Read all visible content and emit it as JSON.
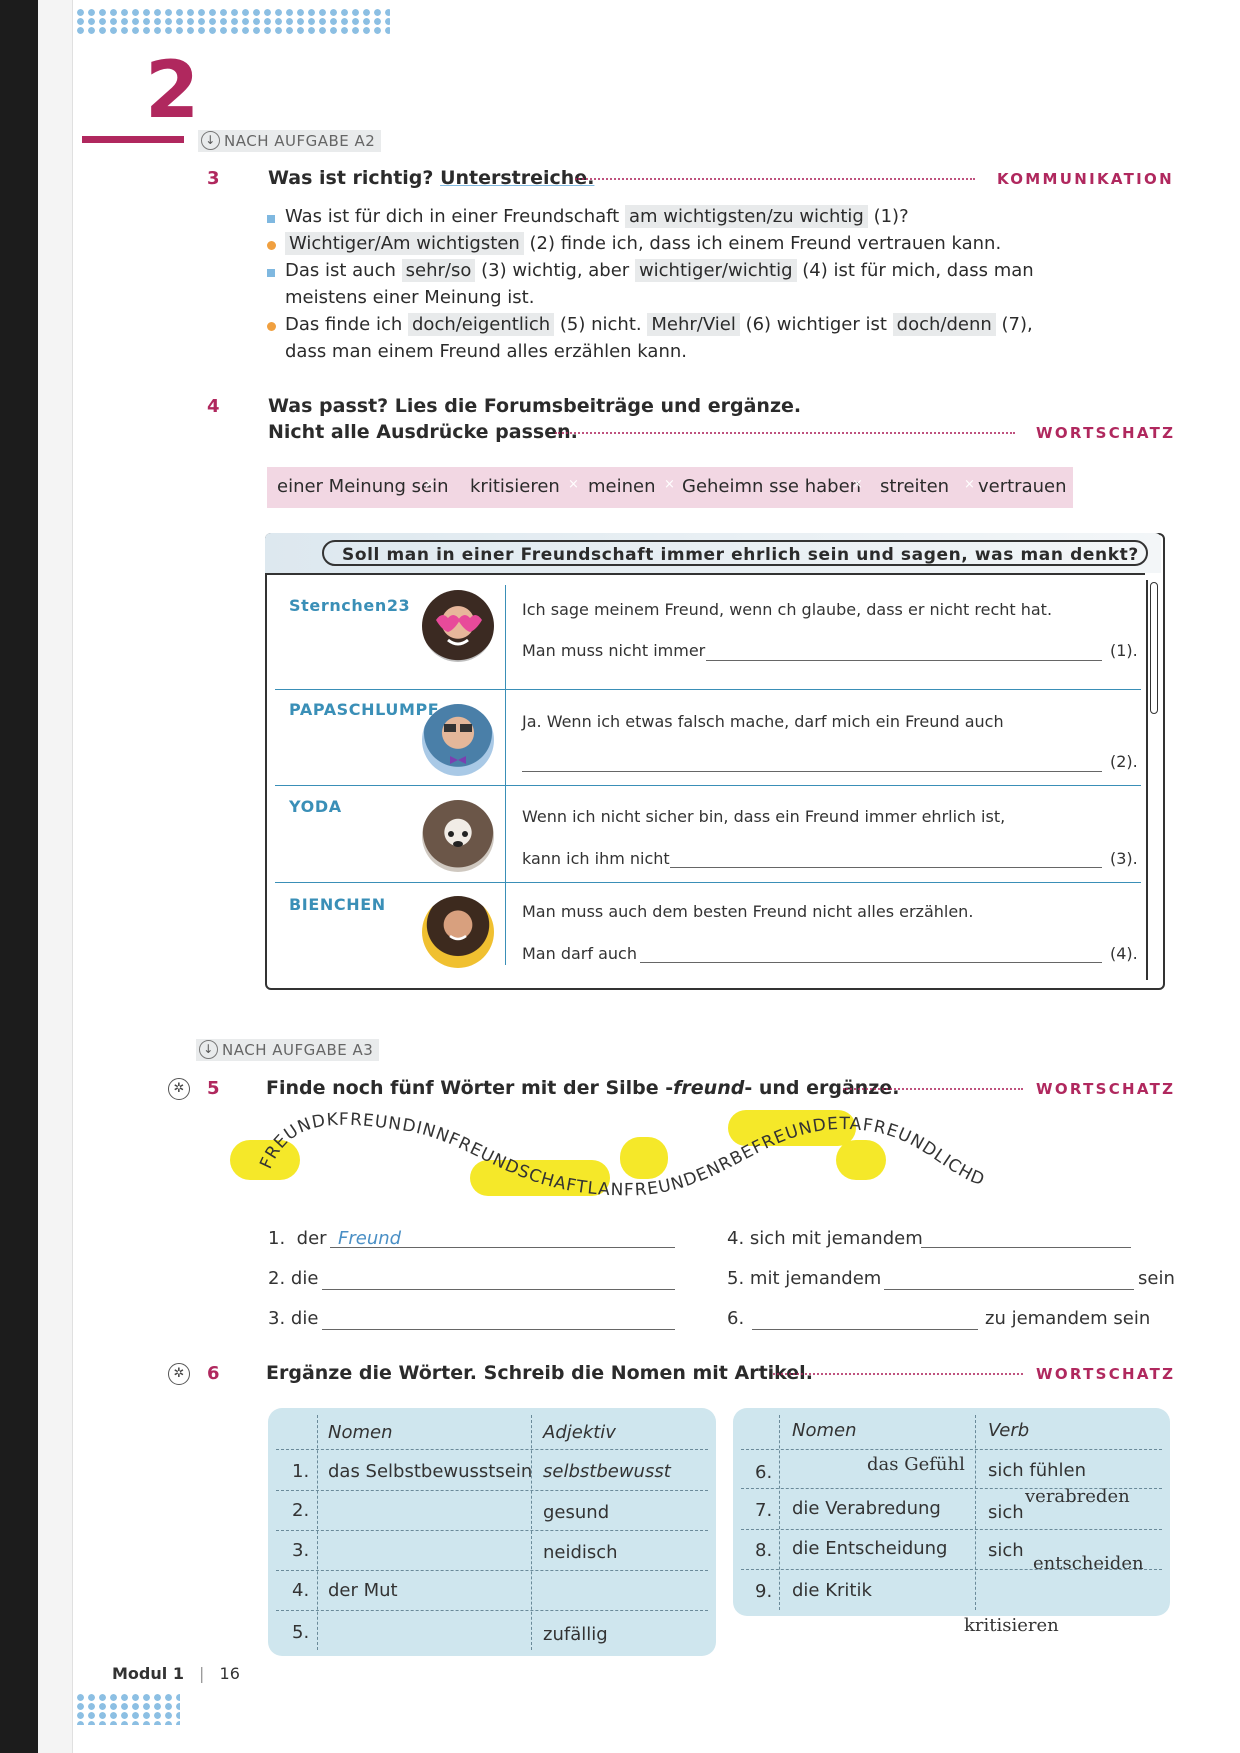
{
  "page": {
    "chapter_number": "2",
    "footer_module": "Modul 1",
    "footer_sep": "|",
    "footer_page": "16"
  },
  "section_a2": {
    "label": "NACH AUFGABE A2"
  },
  "ex3": {
    "number": "3",
    "title_a": "Was ist richtig?",
    "title_b": "Unterstreiche.",
    "tag": "KOMMUNIKATION",
    "lines": [
      {
        "pre": "Was ist für dich in einer Freundschaft",
        "opt": "am wichtigsten/zu wichtig",
        "post": "(1)?"
      },
      {
        "pre": "",
        "opt": "Wichtiger/Am wichtigsten",
        "post": "(2) finde ich, dass ich einem Freund vertrauen kann."
      },
      {
        "pre": "Das ist auch",
        "opt": "sehr/so",
        "mid": "(3) wichtig, aber",
        "opt2": "wichtiger/wichtig",
        "post": "(4) ist für mich, dass man"
      },
      {
        "pre": "meistens einer Meinung ist."
      },
      {
        "pre": "Das finde ich",
        "opt": "doch/eigentlich",
        "mid": "(5) nicht.",
        "opt2": "Mehr/Viel",
        "mid2": "(6) wichtiger ist",
        "opt3": "doch/denn",
        "post": "(7),"
      },
      {
        "pre": "dass man einem Freund alles erzählen kann."
      }
    ]
  },
  "ex4": {
    "number": "4",
    "title_l1": "Was passt? Lies die Forumsbeiträge und ergänze.",
    "title_l2": "Nicht alle Ausdrücke passen.",
    "tag": "WORTSCHATZ",
    "words": [
      "einer Meinung sein",
      "kritisieren",
      "meinen",
      "Geheimn sse haben",
      "streiten",
      "vertrauen"
    ],
    "forum_question": "Soll man in einer Freundschaft immer ehrlich sein und sagen, was man denkt?",
    "posts": [
      {
        "user": "Sternchen23",
        "l1": "Ich sage meinem Freund, wenn  ch glaube, dass er nicht recht hat.",
        "l2": "Man muss nicht immer",
        "num": "(1)."
      },
      {
        "user": "PAPASCHLUMPF",
        "l1": "Ja. Wenn ich etwas falsch mache, darf mich ein Freund auch",
        "l2": "",
        "num": "(2)."
      },
      {
        "user": "YODA",
        "l1": "Wenn ich nicht sicher bin, dass ein Freund immer ehrlich ist,",
        "l2": "kann ich ihm nicht",
        "num": "(3)."
      },
      {
        "user": "BIENCHEN",
        "l1": "Man muss auch dem besten Freund nicht alles erzählen.",
        "l2": "Man darf auch",
        "num": "(4)."
      }
    ]
  },
  "section_a3": {
    "label": "NACH AUFGABE A3"
  },
  "ex5": {
    "number": "5",
    "title_a": "Finde noch fünf Wörter mit der Silbe -",
    "title_b": "freund",
    "title_c": "- und ergänze.",
    "tag": "WORTSCHATZ",
    "snake": "FREUNDKFREUNDINNFREUNDSCHAFTLANFREUNDENRBEFREUNDETAFREUNDLICHD",
    "items": [
      {
        "n": "1.",
        "label": "der",
        "answer": "Freund"
      },
      {
        "n": "2.",
        "label": "die",
        "answer": ""
      },
      {
        "n": "3.",
        "label": "die",
        "answer": ""
      },
      {
        "n": "4.",
        "label": "sich mit jemandem",
        "answer": ""
      },
      {
        "n": "5.",
        "label": "mit jemandem",
        "suffix": "sein",
        "answer": ""
      },
      {
        "n": "6.",
        "label": "",
        "suffix": "zu jemandem sein",
        "answer": ""
      }
    ]
  },
  "ex6": {
    "number": "6",
    "title": "Ergänze die Wörter. Schreib die Nomen mit Artikel.",
    "tag": "WORTSCHATZ",
    "left_table": {
      "headers": [
        "Nomen",
        "Adjektiv"
      ],
      "rows": [
        {
          "n": "1.",
          "nomen": "das Selbstbewusstsein",
          "adj": "selbstbewusst"
        },
        {
          "n": "2.",
          "nomen": "",
          "adj": "gesund"
        },
        {
          "n": "3.",
          "nomen": "",
          "adj": "neidisch"
        },
        {
          "n": "4.",
          "nomen": "der Mut",
          "adj": ""
        },
        {
          "n": "5.",
          "nomen": "",
          "adj": "zufällig"
        }
      ]
    },
    "right_table": {
      "headers": [
        "Nomen",
        "Verb"
      ],
      "rows": [
        {
          "n": "6.",
          "nomen": "das Gefühl",
          "verb": "sich fühlen"
        },
        {
          "n": "7.",
          "nomen": "die Verabredung",
          "verb": "sich",
          "verb_hand": "verabreden"
        },
        {
          "n": "8.",
          "nomen": "die Entscheidung",
          "verb": "sich",
          "verb_hand": "entscheiden"
        },
        {
          "n": "9.",
          "nomen": "die Kritik",
          "verb_hand": "kritisieren"
        }
      ]
    }
  },
  "colors": {
    "accent": "#b0285e",
    "blue": "#3a8fb7",
    "pinkbox": "#f2d7e3",
    "tablebg": "#cfe6ee",
    "highlight": "#f5e829"
  }
}
